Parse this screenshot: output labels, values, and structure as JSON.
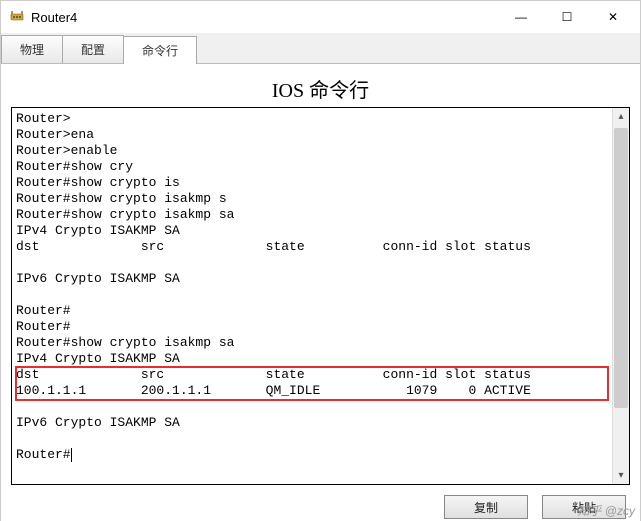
{
  "window": {
    "title": "Router4",
    "controls": {
      "min": "—",
      "max": "☐",
      "close": "✕"
    }
  },
  "tabs": [
    {
      "label": "物理"
    },
    {
      "label": "配置"
    },
    {
      "label": "命令行",
      "active": true
    }
  ],
  "panel_title": "IOS 命令行",
  "terminal_lines": [
    "Router>",
    "Router>ena",
    "Router>enable",
    "Router#show cry",
    "Router#show crypto is",
    "Router#show crypto isakmp s",
    "Router#show crypto isakmp sa",
    "IPv4 Crypto ISAKMP SA",
    "dst             src             state          conn-id slot status",
    "",
    "IPv6 Crypto ISAKMP SA",
    "",
    "Router#",
    "Router#",
    "Router#show crypto isakmp sa",
    "IPv4 Crypto ISAKMP SA",
    "dst             src             state          conn-id slot status",
    "100.1.1.1       200.1.1.1       QM_IDLE           1079    0 ACTIVE",
    "",
    "IPv6 Crypto ISAKMP SA",
    "",
    "Router#"
  ],
  "highlight": {
    "from_line": 16,
    "to_line": 17
  },
  "buttons": {
    "copy": "复制",
    "paste": "粘贴"
  },
  "watermark": "知乎 @zcy"
}
